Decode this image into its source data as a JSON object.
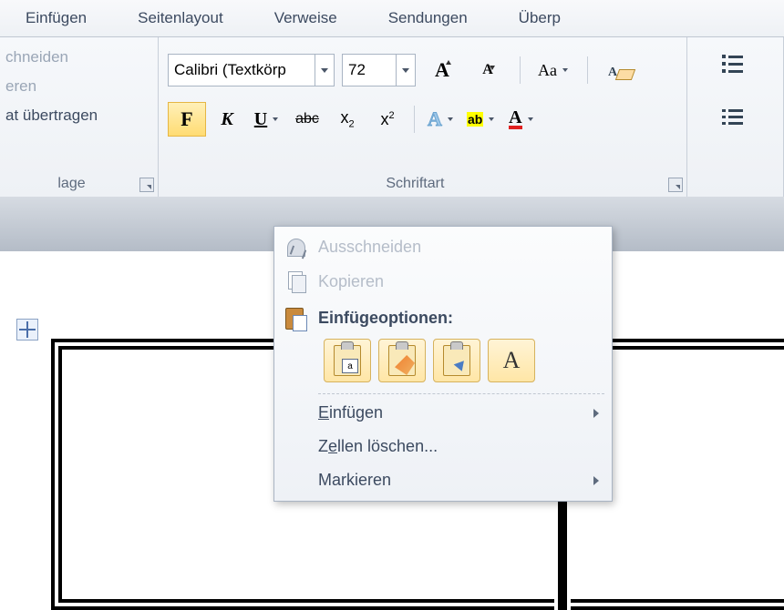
{
  "tabs": {
    "insert": "Einfügen",
    "layout": "Seitenlayout",
    "refs": "Verweise",
    "mail": "Sendungen",
    "review": "Überp"
  },
  "clipboard": {
    "cut_partial": "chneiden",
    "copy_partial": "eren",
    "format_painter_partial": "at übertragen",
    "group_label": "lage"
  },
  "font": {
    "name": "Calibri (Textkörp",
    "size": "72",
    "group_label": "Schriftart",
    "strike_sample": "abc",
    "highlight_sample": "ab"
  },
  "ctx": {
    "cut": "Ausschneiden",
    "copy": "Kopieren",
    "paste_header": "Einfügeoptionen:",
    "insert_u": "E",
    "insert_rest": "infügen",
    "delete_pre": "Z",
    "delete_u": "e",
    "delete_rest": "llen löschen...",
    "select": "Markieren"
  }
}
